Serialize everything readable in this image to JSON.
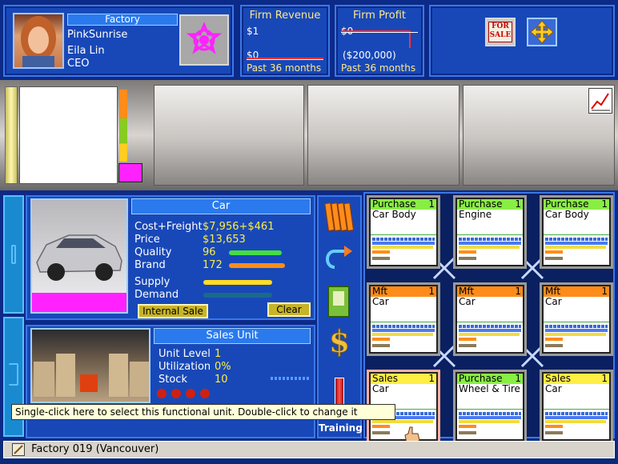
{
  "ceo": {
    "title": "Factory",
    "company": "PinkSunrise",
    "name": "Eila Lin",
    "role": "CEO"
  },
  "revenue": {
    "title": "Firm Revenue",
    "top_value": "$1",
    "bottom_value": "$0",
    "period": "Past 36 months"
  },
  "profit": {
    "title": "Firm Profit",
    "top_value": "$0",
    "bottom_value": "($200,000)",
    "period": "Past 36 months"
  },
  "product": {
    "name": "Car",
    "cost_label": "Cost+Freight",
    "cost_value": "$7,956+$461",
    "price_label": "Price",
    "price_value": "$13,653",
    "quality_label": "Quality",
    "quality_value": "96",
    "brand_label": "Brand",
    "brand_value": "172",
    "supply_label": "Supply",
    "demand_label": "Demand",
    "internal_sale_label": "Internal Sale",
    "clear_label": "Clear"
  },
  "unit_info": {
    "title": "Sales Unit",
    "level_label": "Unit Level",
    "level_value": "1",
    "util_label": "Utilization",
    "util_value": "0%",
    "stock_label": "Stock",
    "stock_value": "10"
  },
  "training_label": "Training",
  "units": [
    {
      "type": "Purchase",
      "level": "1",
      "product": "Car Body",
      "color": "#88ee44"
    },
    {
      "type": "Purchase",
      "level": "1",
      "product": "Engine",
      "color": "#88ee44"
    },
    {
      "type": "Purchase",
      "level": "1",
      "product": "Car Body",
      "color": "#88ee44"
    },
    {
      "type": "Mft",
      "level": "1",
      "product": "Car",
      "color": "#ff8c1a"
    },
    {
      "type": "Mft",
      "level": "1",
      "product": "Car",
      "color": "#ff8c1a"
    },
    {
      "type": "Mft",
      "level": "1",
      "product": "Car",
      "color": "#ff8c1a"
    },
    {
      "type": "Sales",
      "level": "1",
      "product": "Car",
      "color": "#ffee44"
    },
    {
      "type": "Purchase",
      "level": "1",
      "product": "Wheel & Tire",
      "color": "#88ee44"
    },
    {
      "type": "Sales",
      "level": "1",
      "product": "Car",
      "color": "#ffee44"
    }
  ],
  "tooltip": "Single-click here to select this functional unit. Double-click to change it",
  "status": "Factory 019 (Vancouver)",
  "sale_sign": "FOR SALE",
  "icons": [
    "sale-sign-icon",
    "move-arrows-icon",
    "chart-line-icon",
    "books-icon",
    "route-arrow-icon",
    "manual-icon",
    "dollar-icon",
    "pencil-icon"
  ]
}
